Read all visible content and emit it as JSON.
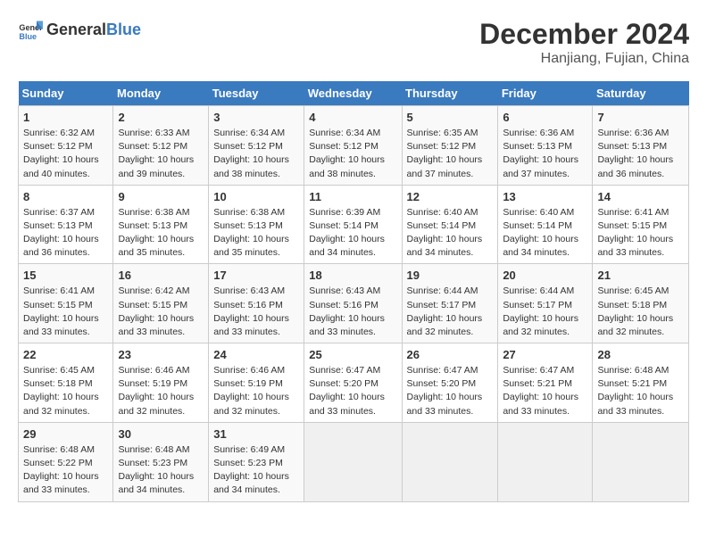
{
  "header": {
    "logo_general": "General",
    "logo_blue": "Blue",
    "month": "December 2024",
    "location": "Hanjiang, Fujian, China"
  },
  "weekdays": [
    "Sunday",
    "Monday",
    "Tuesday",
    "Wednesday",
    "Thursday",
    "Friday",
    "Saturday"
  ],
  "weeks": [
    [
      {
        "day": "1",
        "info": "Sunrise: 6:32 AM\nSunset: 5:12 PM\nDaylight: 10 hours and 40 minutes."
      },
      {
        "day": "2",
        "info": "Sunrise: 6:33 AM\nSunset: 5:12 PM\nDaylight: 10 hours and 39 minutes."
      },
      {
        "day": "3",
        "info": "Sunrise: 6:34 AM\nSunset: 5:12 PM\nDaylight: 10 hours and 38 minutes."
      },
      {
        "day": "4",
        "info": "Sunrise: 6:34 AM\nSunset: 5:12 PM\nDaylight: 10 hours and 38 minutes."
      },
      {
        "day": "5",
        "info": "Sunrise: 6:35 AM\nSunset: 5:12 PM\nDaylight: 10 hours and 37 minutes."
      },
      {
        "day": "6",
        "info": "Sunrise: 6:36 AM\nSunset: 5:13 PM\nDaylight: 10 hours and 37 minutes."
      },
      {
        "day": "7",
        "info": "Sunrise: 6:36 AM\nSunset: 5:13 PM\nDaylight: 10 hours and 36 minutes."
      }
    ],
    [
      {
        "day": "8",
        "info": "Sunrise: 6:37 AM\nSunset: 5:13 PM\nDaylight: 10 hours and 36 minutes."
      },
      {
        "day": "9",
        "info": "Sunrise: 6:38 AM\nSunset: 5:13 PM\nDaylight: 10 hours and 35 minutes."
      },
      {
        "day": "10",
        "info": "Sunrise: 6:38 AM\nSunset: 5:13 PM\nDaylight: 10 hours and 35 minutes."
      },
      {
        "day": "11",
        "info": "Sunrise: 6:39 AM\nSunset: 5:14 PM\nDaylight: 10 hours and 34 minutes."
      },
      {
        "day": "12",
        "info": "Sunrise: 6:40 AM\nSunset: 5:14 PM\nDaylight: 10 hours and 34 minutes."
      },
      {
        "day": "13",
        "info": "Sunrise: 6:40 AM\nSunset: 5:14 PM\nDaylight: 10 hours and 34 minutes."
      },
      {
        "day": "14",
        "info": "Sunrise: 6:41 AM\nSunset: 5:15 PM\nDaylight: 10 hours and 33 minutes."
      }
    ],
    [
      {
        "day": "15",
        "info": "Sunrise: 6:41 AM\nSunset: 5:15 PM\nDaylight: 10 hours and 33 minutes."
      },
      {
        "day": "16",
        "info": "Sunrise: 6:42 AM\nSunset: 5:15 PM\nDaylight: 10 hours and 33 minutes."
      },
      {
        "day": "17",
        "info": "Sunrise: 6:43 AM\nSunset: 5:16 PM\nDaylight: 10 hours and 33 minutes."
      },
      {
        "day": "18",
        "info": "Sunrise: 6:43 AM\nSunset: 5:16 PM\nDaylight: 10 hours and 33 minutes."
      },
      {
        "day": "19",
        "info": "Sunrise: 6:44 AM\nSunset: 5:17 PM\nDaylight: 10 hours and 32 minutes."
      },
      {
        "day": "20",
        "info": "Sunrise: 6:44 AM\nSunset: 5:17 PM\nDaylight: 10 hours and 32 minutes."
      },
      {
        "day": "21",
        "info": "Sunrise: 6:45 AM\nSunset: 5:18 PM\nDaylight: 10 hours and 32 minutes."
      }
    ],
    [
      {
        "day": "22",
        "info": "Sunrise: 6:45 AM\nSunset: 5:18 PM\nDaylight: 10 hours and 32 minutes."
      },
      {
        "day": "23",
        "info": "Sunrise: 6:46 AM\nSunset: 5:19 PM\nDaylight: 10 hours and 32 minutes."
      },
      {
        "day": "24",
        "info": "Sunrise: 6:46 AM\nSunset: 5:19 PM\nDaylight: 10 hours and 32 minutes."
      },
      {
        "day": "25",
        "info": "Sunrise: 6:47 AM\nSunset: 5:20 PM\nDaylight: 10 hours and 33 minutes."
      },
      {
        "day": "26",
        "info": "Sunrise: 6:47 AM\nSunset: 5:20 PM\nDaylight: 10 hours and 33 minutes."
      },
      {
        "day": "27",
        "info": "Sunrise: 6:47 AM\nSunset: 5:21 PM\nDaylight: 10 hours and 33 minutes."
      },
      {
        "day": "28",
        "info": "Sunrise: 6:48 AM\nSunset: 5:21 PM\nDaylight: 10 hours and 33 minutes."
      }
    ],
    [
      {
        "day": "29",
        "info": "Sunrise: 6:48 AM\nSunset: 5:22 PM\nDaylight: 10 hours and 33 minutes."
      },
      {
        "day": "30",
        "info": "Sunrise: 6:48 AM\nSunset: 5:23 PM\nDaylight: 10 hours and 34 minutes."
      },
      {
        "day": "31",
        "info": "Sunrise: 6:49 AM\nSunset: 5:23 PM\nDaylight: 10 hours and 34 minutes."
      },
      null,
      null,
      null,
      null
    ]
  ]
}
